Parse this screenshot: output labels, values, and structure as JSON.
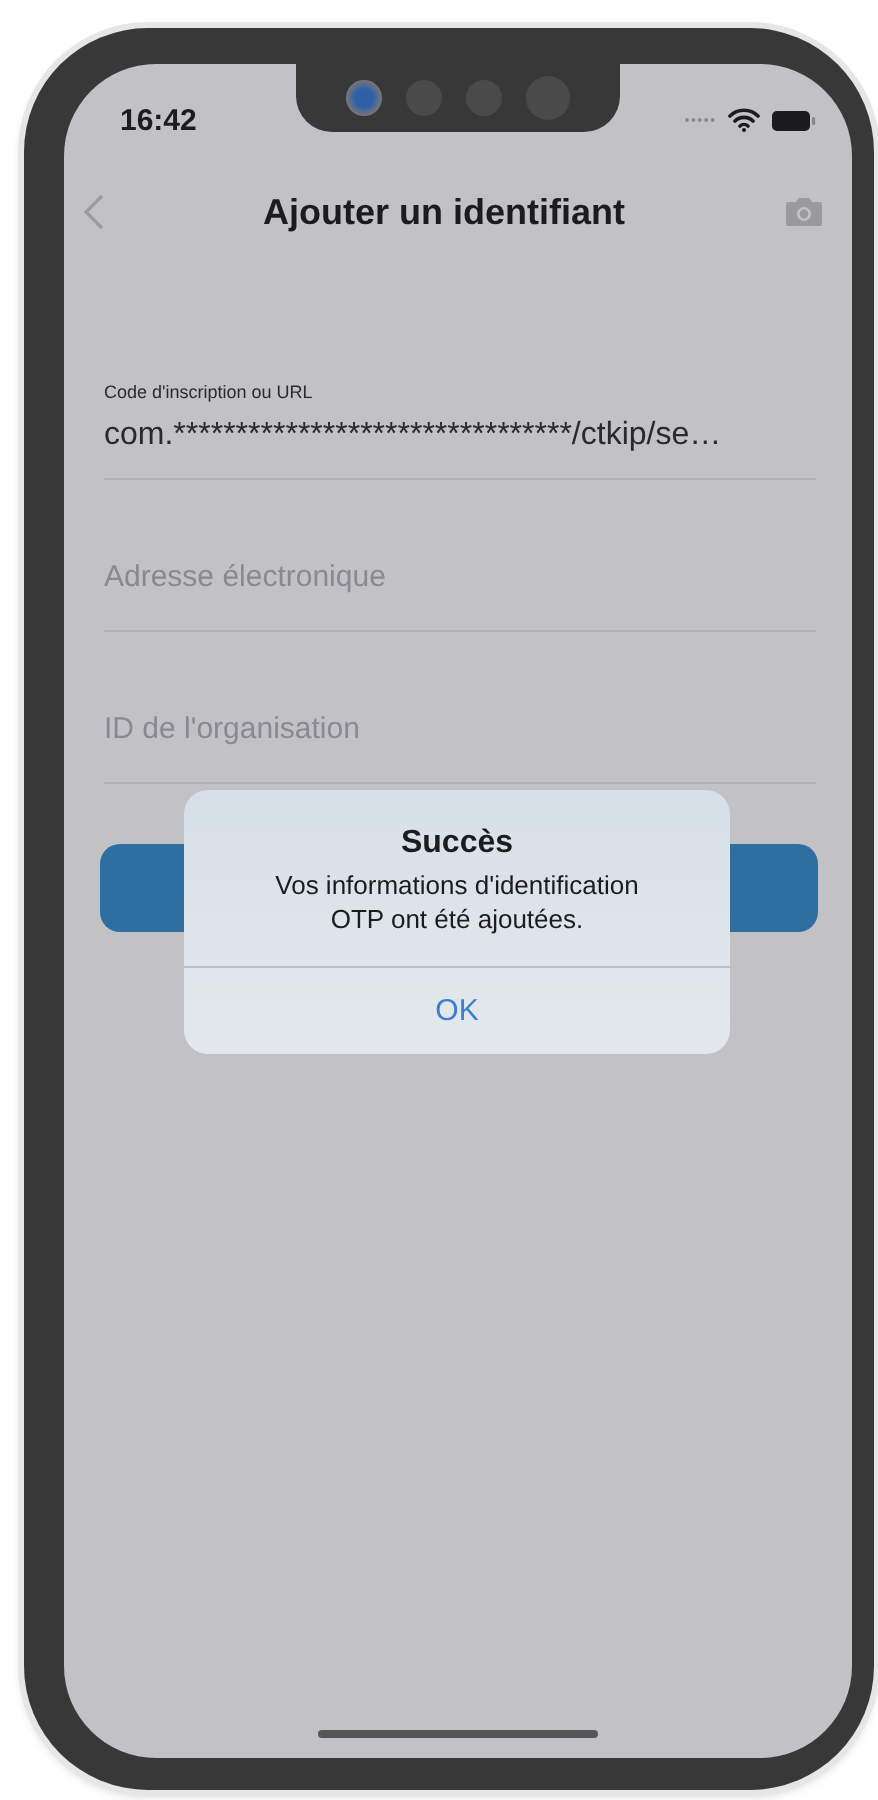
{
  "status_bar": {
    "time": "16:42"
  },
  "nav": {
    "title": "Ajouter un identifiant"
  },
  "fields": [
    {
      "kind": "filled",
      "label": "Code d'inscription ou URL",
      "value": "com.********************************/ctkip/se…"
    },
    {
      "kind": "empty",
      "placeholder": "Adresse électronique"
    },
    {
      "kind": "empty",
      "placeholder": "ID de l'organisation"
    }
  ],
  "alert": {
    "title": "Succès",
    "message": "Vos informations d'identification OTP ont été ajoutées.",
    "button": "OK"
  }
}
